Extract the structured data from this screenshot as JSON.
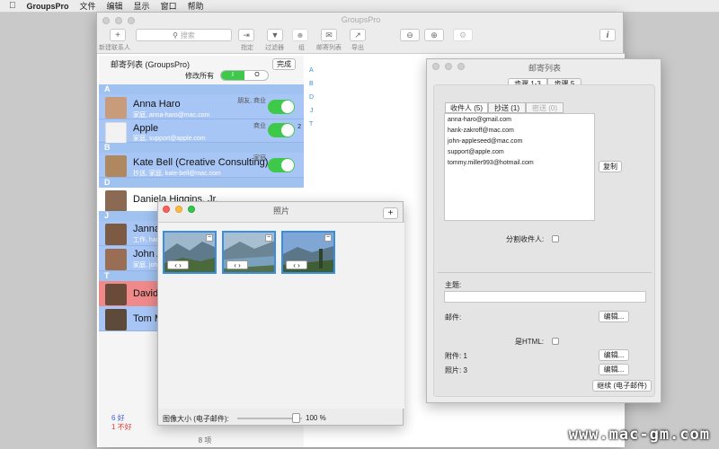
{
  "menubar": {
    "apple": "",
    "app": "GroupsPro",
    "items": [
      "文件",
      "编辑",
      "显示",
      "窗口",
      "帮助"
    ]
  },
  "main_window": {
    "title": "GroupsPro",
    "toolbar": {
      "new_contact": "新建联系人",
      "search_placeholder": "搜索",
      "assign": "指定",
      "filter": "过滤器",
      "group": "组",
      "mailing_list": "邮寄列表",
      "export": "导出",
      "add_glyph": "+",
      "info_glyph": "i"
    },
    "list_header": {
      "title": "邮寄列表 (GroupsPro)",
      "done": "完成",
      "modify_all": "修改所有",
      "on": "I",
      "off": "O"
    },
    "index_letters": [
      "A",
      "B",
      "D",
      "J",
      "T"
    ],
    "sections": {
      "a": "A",
      "b": "B",
      "d": "D",
      "j": "J",
      "t": "T"
    },
    "contacts": [
      {
        "name": "Anna Haro",
        "sub": "家庭, anna-haro@mac.com",
        "tag": "朋友, 商业"
      },
      {
        "name": "Apple",
        "sub": "家庭, support@apple.com",
        "tag": "商业"
      },
      {
        "name": "Kate Bell (Creative Consulting)",
        "sub": "抄送, 家庭, kate-bell@mac.com",
        "tag": "家庭"
      },
      {
        "name": "Daniela Higgins, Jr.",
        "sub": "",
        "tag": ""
      },
      {
        "name": "Janna",
        "sub": "工作, hank-z",
        "tag": ""
      },
      {
        "name": "John A",
        "sub": "家庭, john-",
        "tag": ""
      },
      {
        "name": "David",
        "sub": "",
        "tag": ""
      },
      {
        "name": "Tom M",
        "sub": "",
        "tag": ""
      }
    ],
    "badge_count": "2",
    "footer": {
      "good": "6 好",
      "bad": "1 不好",
      "count": "8 项"
    }
  },
  "mail_window": {
    "title": "邮寄列表",
    "segments": [
      "步骤 1-3",
      "步骤 5"
    ],
    "tabs": [
      "收件人 (5)",
      "抄送 (1)",
      "密送 (0)"
    ],
    "emails": [
      "anna-haro@gmail.com",
      "hank-zakroff@mac.com",
      "john-appleseed@mac.com",
      "support@apple.com",
      "tommy.miller993@hotmail.com"
    ],
    "copy": "复制",
    "split_label": "分割收件人:",
    "subject_label": "主题:",
    "body_label": "邮件:",
    "edit": "编辑...",
    "html_label": "是HTML:",
    "attachments": "附件: 1",
    "photos": "照片: 3",
    "continue": "继续 (电子邮件)"
  },
  "photo_window": {
    "title": "照片",
    "add": "+",
    "size_label": "图像大小 (电子邮件):",
    "size_value": "100 %",
    "size_fraction": 0.9,
    "photo_count": 3
  },
  "watermark": "www.mac-gm.com",
  "colors": {
    "selection": "#a8c6f5",
    "toggle": "#3fc94b",
    "accent": "#3b8de0",
    "bad": "#e23b3b",
    "good": "#3b5ee0"
  }
}
